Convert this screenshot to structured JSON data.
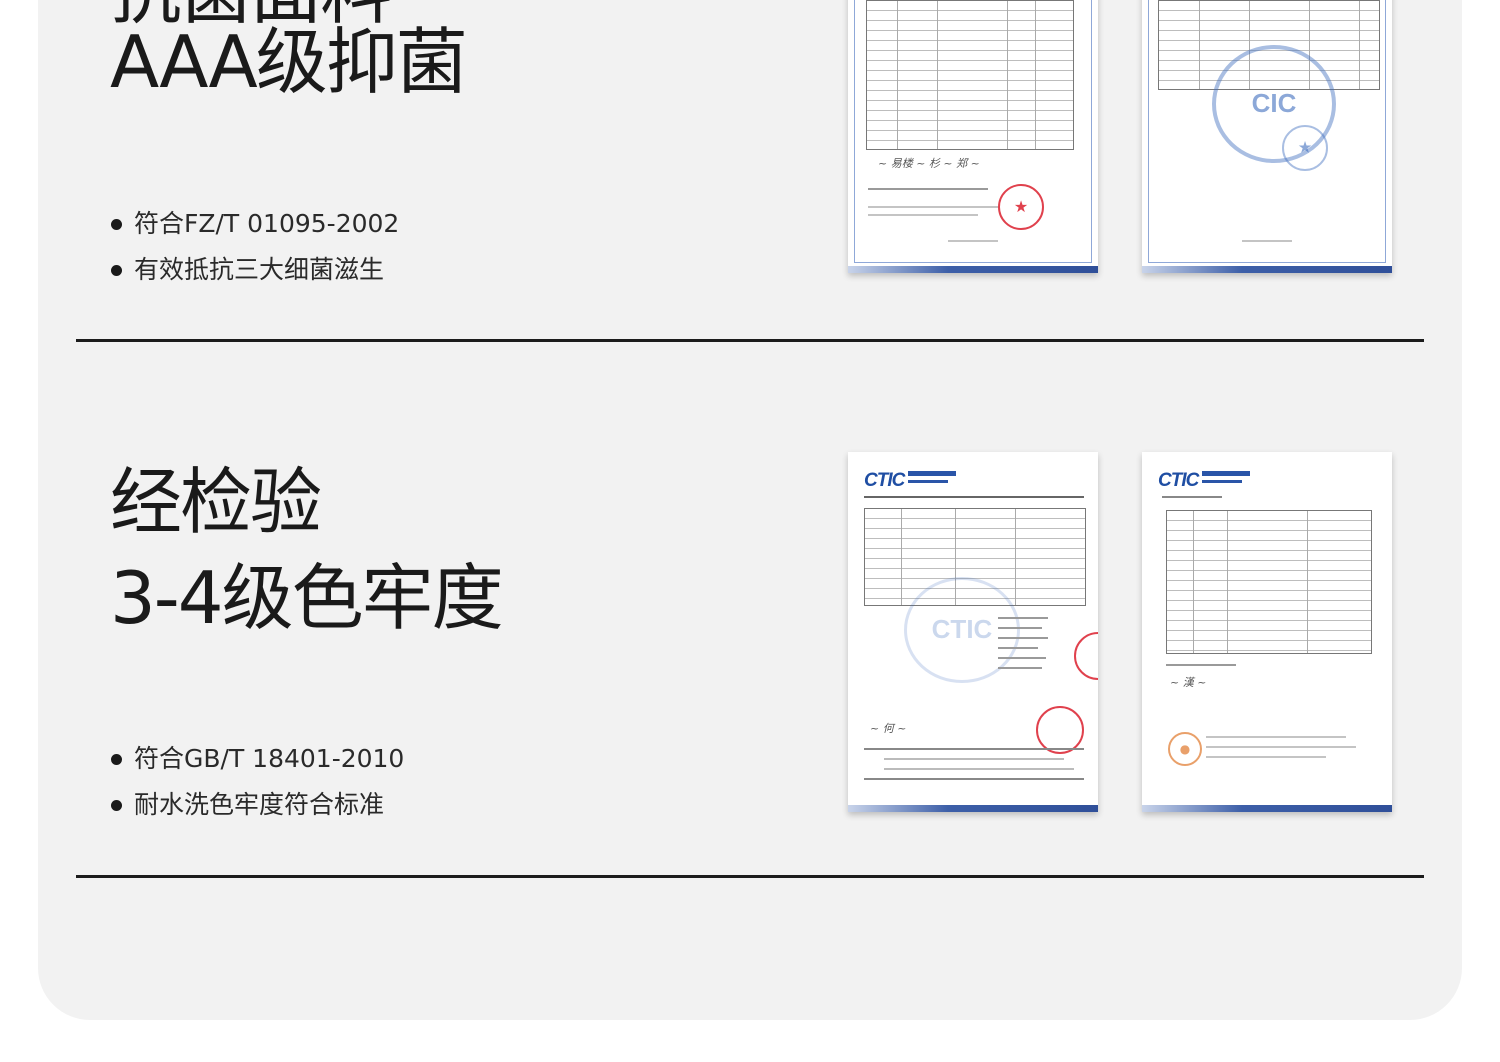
{
  "section1": {
    "title_line1": "抗菌面料",
    "title_line2": "AAA级抑菌",
    "bullets": [
      "符合FZ/T 01095-2002",
      "有效抵抗三大细菌滋生"
    ]
  },
  "section2": {
    "title_line1": "经检验",
    "title_line2": "3-4级色牢度",
    "bullets": [
      "符合GB/T 18401-2010",
      "耐水洗色牢度符合标准"
    ]
  },
  "certificates": {
    "logo_text": "CTIC",
    "seal_text": "CIC"
  }
}
